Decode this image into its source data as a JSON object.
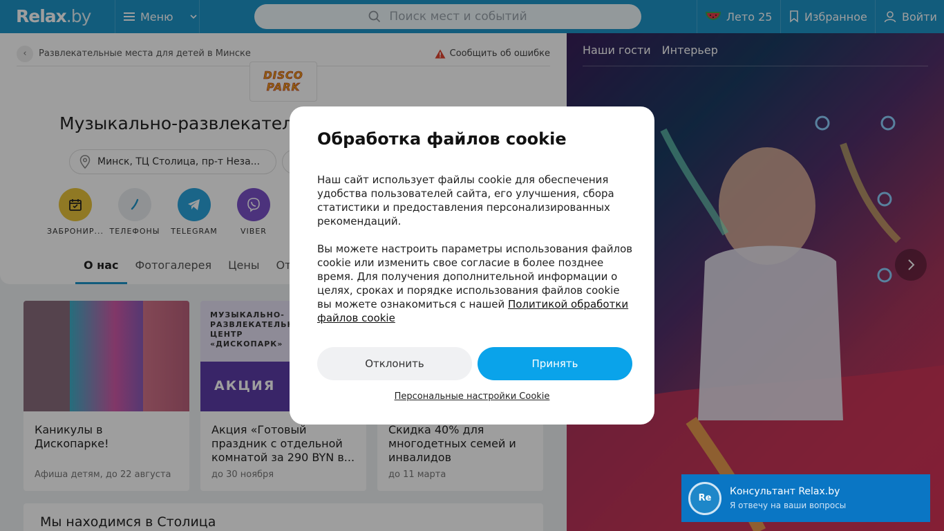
{
  "header": {
    "logo": "Relax",
    "logo_suffix": ".by",
    "menu_label": "Меню",
    "search_placeholder": "Поиск мест и событий",
    "summer_label": "Лето 25",
    "favorites_label": "Избранное",
    "login_label": "Войти"
  },
  "breadcrumb": {
    "label": "Развлекательные места для детей в Минске",
    "report_label": "Сообщить об ошибке"
  },
  "venue": {
    "logo_line1": "DISCO",
    "logo_line2": "PARK",
    "title": "Музыкально-развлекатель",
    "address": "Минск, ТЦ Столица, пр-т Неза..."
  },
  "actions": [
    {
      "label": "Забронир..."
    },
    {
      "label": "Телефоны"
    },
    {
      "label": "Telegram"
    },
    {
      "label": "Viber"
    }
  ],
  "tabs": [
    {
      "label": "О нас"
    },
    {
      "label": "Фотогалерея"
    },
    {
      "label": "Цены"
    },
    {
      "label": "Отзы"
    }
  ],
  "promos": [
    {
      "title": "Каникулы в Дископарке!",
      "date": "Афиша детям, до 22 августа"
    },
    {
      "title": "Акция «Готовый праздник с отдельной комнатой за 290 BYN в...",
      "date": "до 30 ноября",
      "banner_text": "МУЗЫКАЛЬНО-РАЗВЛЕКАТЕЛЬНЫЙ ЦЕНТР «ДИСКОПАРК»",
      "banner_badge": "АКЦИЯ"
    },
    {
      "title": "Скидка 40% для многодетных семей и инвалидов",
      "date": "до 11 марта"
    }
  ],
  "location_title": "Мы находимся в Столица",
  "photo": {
    "tabs": [
      "Наши гости",
      "Интерьер"
    ]
  },
  "cookie": {
    "title": "Обработка файлов cookie",
    "para1": "Наш сайт использует файлы cookie для обеспечения удобства пользователей сайта, его улучшения, сбора статистики и предоставления персонализированных рекомендаций.",
    "para2": "Вы можете настроить параметры использования файлов cookie или изменить свое согласие в более позднее время. Для получения дополнительной информации о целях, сроках и порядке использования файлов cookie вы можете ознакомиться с нашей",
    "policy_link": "Политикой обработки файлов cookie",
    "decline": "Отклонить",
    "accept": "Принять",
    "personal": "Персональные настройки Cookie"
  },
  "chat": {
    "avatar": "Re",
    "name": "Консультант Relax.by",
    "subtitle": "Я отвечу на ваши вопросы"
  },
  "colors": {
    "brand": "#1e95c9",
    "accept": "#0aa3ea",
    "chat": "#0a76c4"
  }
}
